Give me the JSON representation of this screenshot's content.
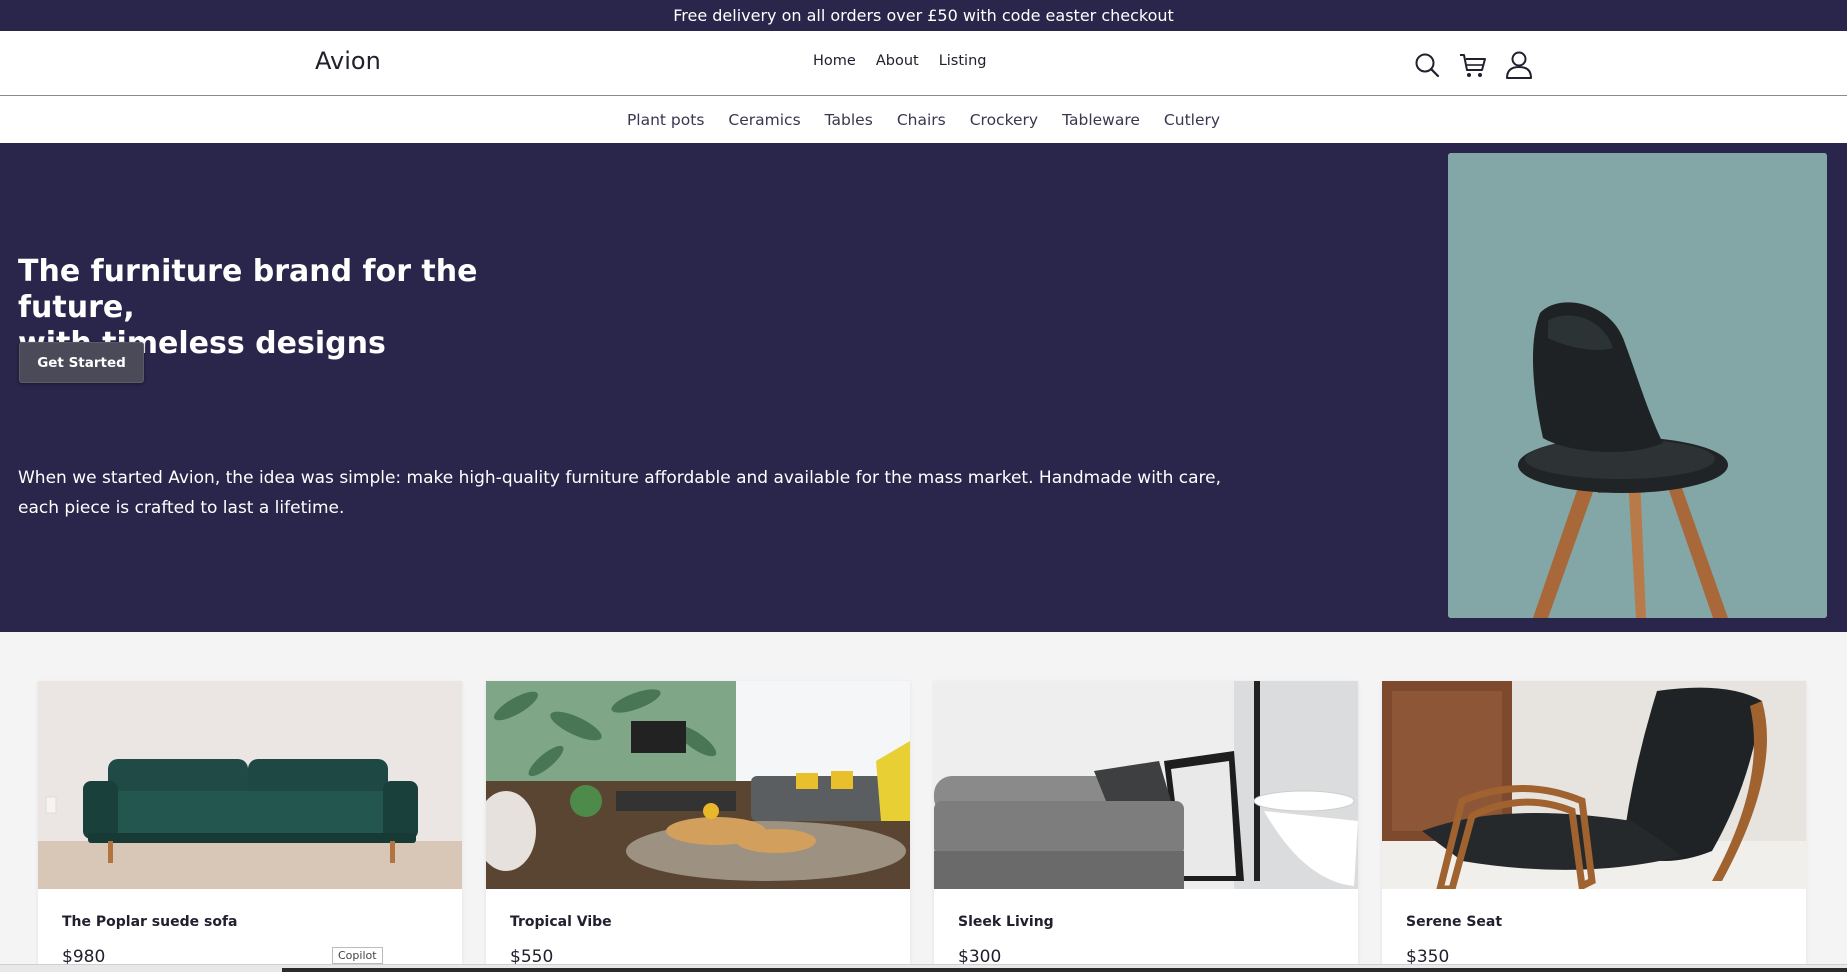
{
  "promo": {
    "text": "Free delivery on all orders over £50 with code easter checkout"
  },
  "header": {
    "brand": "Avion",
    "nav": [
      "Home",
      "About",
      "Listing"
    ],
    "icons": [
      "search-icon",
      "cart-icon",
      "user-icon"
    ]
  },
  "categories": [
    "Plant pots",
    "Ceramics",
    "Tables",
    "Chairs",
    "Crockery",
    "Tableware",
    "Cutlery"
  ],
  "hero": {
    "title_line1": "The furniture brand for the future,",
    "title_line2": "with timeless designs",
    "button": "Get Started",
    "description": "When we started Avion, the idea was simple: make high-quality furniture affordable and available for the mass market. Handmade with care, each piece is crafted to last a lifetime."
  },
  "products": [
    {
      "name": "The Poplar suede sofa",
      "price": "$980"
    },
    {
      "name": "Tropical Vibe",
      "price": "$550"
    },
    {
      "name": "Sleek Living",
      "price": "$300"
    },
    {
      "name": "Serene Seat",
      "price": "$350"
    }
  ],
  "tooltip": "Copilot",
  "colors": {
    "brand_dark": "#2a254b",
    "hero_image_bg": "#83a6a7",
    "button": "#4a4a58"
  }
}
